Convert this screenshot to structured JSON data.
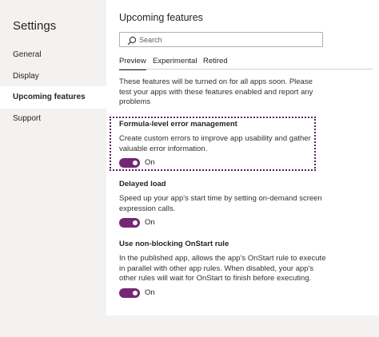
{
  "sidebar": {
    "title": "Settings",
    "items": [
      {
        "label": "General"
      },
      {
        "label": "Display"
      },
      {
        "label": "Upcoming features"
      },
      {
        "label": "Support"
      }
    ],
    "active_index": 2
  },
  "main": {
    "title": "Upcoming features",
    "search": {
      "placeholder": "Search",
      "value": ""
    },
    "tabs": [
      {
        "label": "Preview",
        "selected": true
      },
      {
        "label": "Experimental",
        "selected": false
      },
      {
        "label": "Retired",
        "selected": false
      }
    ],
    "intro": "These features will be turned on for all apps soon. Please test your apps with these features enabled and report any problems",
    "features": [
      {
        "title": "Formula-level error management",
        "description": "Create custom errors to improve app usability and gather valuable error information.",
        "toggle_label": "On",
        "on": true
      },
      {
        "title": "Delayed load",
        "description": "Speed up your app's start time by setting on-demand screen expression calls.",
        "toggle_label": "On",
        "on": true
      },
      {
        "title": "Use non-blocking OnStart rule",
        "description": "In the published app, allows the app's OnStart rule to execute in parallel with other app rules. When disabled, your app's other rules will wait for OnStart to finish before executing.",
        "toggle_label": "On",
        "on": true
      }
    ]
  },
  "colors": {
    "accent": "#742774",
    "highlight_border": "#5c1f63",
    "sidebar_bg": "#f3f2f1",
    "active_nav_bg": "#ffffff"
  },
  "icons": {
    "search": "search-icon"
  }
}
